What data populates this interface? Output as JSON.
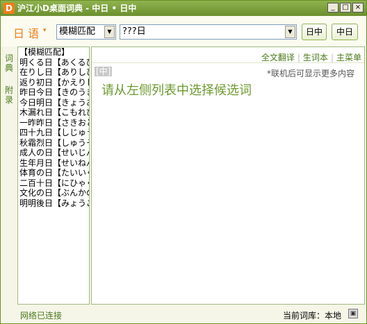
{
  "window": {
    "title": "沪江小D桌面词典 - 中日 • 日中",
    "icon_letter": "D",
    "minimize_glyph": "_",
    "maximize_glyph": "□",
    "close_glyph": "×"
  },
  "toolbar": {
    "language": "日 语",
    "language_caret": "▾",
    "mode_value": "模糊匹配",
    "search_value": "???日",
    "dropdown_glyph": "▼",
    "btn_jc": "日中",
    "btn_cj": "中日"
  },
  "side_tabs": {
    "dict": "词典",
    "appendix": "附录"
  },
  "list": {
    "items": [
      "【模糊匹配】",
      "明くる日【あくるひ】",
      "在りし日【ありしひ】",
      "返り初日【かえりしょにち】",
      "昨日今日【きのうきょう】",
      "今日明日【きょうあす】",
      "木漏れ日【こもれび】",
      "一昨昨日【さきおととい】",
      "四十九日【しじゅうくにち】",
      "秋霜烈日【しゅうそうれつじつ】",
      "成人の日【せいじんのひ】",
      "生年月日【せいねんがっぴ】",
      "体育の日【たいいくのひ】",
      "二百十日【にひゃくとおか】",
      "文化の日【ぶんかのひ】",
      "明明後日【みょうごにち】"
    ]
  },
  "content": {
    "links": [
      "全文翻译",
      "生词本",
      "主菜单"
    ],
    "link_separator": "|",
    "lang_tag": "[中]",
    "hint": "*联机后可显示更多内容",
    "prompt": "请从左侧列表中选择候选词"
  },
  "status": {
    "network": "网络已连接",
    "current_dict": "当前词库：本地",
    "icon_glyph": "▣"
  }
}
